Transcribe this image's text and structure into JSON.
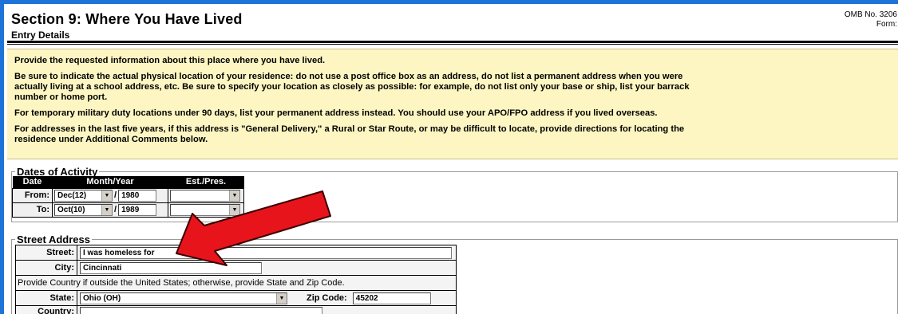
{
  "header": {
    "title": "Section 9: Where You Have Lived",
    "subtitle": "Entry Details",
    "omb_line1": "OMB No. 3206",
    "omb_line2": "Form:"
  },
  "instructions": {
    "p1": "Provide the requested information about this place where you have lived.",
    "p2a": "Be sure to indicate the actual physical location of your residence: do not use a post office box as an address, do not list a permanent address when you were",
    "p2b": "actually living at a school address, etc. Be sure to specify your location as closely as possible: for example, do not list only your base or ship, list your barrack",
    "p2c": "number or home port.",
    "p3": "For temporary military duty locations under 90 days, list your permanent address instead. You should use your APO/FPO address if you lived overseas.",
    "p4a": "For addresses in the last five years, if this address is \"General Delivery,\" a Rural or Star Route, or may be difficult to locate, provide directions for locating the",
    "p4b": "residence under Additional Comments below."
  },
  "dates": {
    "legend": "Dates of Activity",
    "col_date": "Date",
    "col_month_year": "Month/Year",
    "col_est": "Est./Pres.",
    "from_label": "From:",
    "from_month": "Dec(12)",
    "from_year": "1980",
    "from_est": "",
    "to_label": "To:",
    "to_month": "Oct(10)",
    "to_year": "1989",
    "to_est": "",
    "separator": "/"
  },
  "address": {
    "legend": "Street Address",
    "street_label": "Street:",
    "street_value": "I was homeless for",
    "city_label": "City:",
    "city_value": "Cincinnati",
    "note": "Provide Country if outside the United States; otherwise, provide State and Zip Code.",
    "state_label": "State:",
    "state_value": "Ohio (OH)",
    "zip_label": "Zip Code:",
    "zip_value": "45202",
    "country_label": "Country:",
    "country_value": ""
  },
  "annotation": {
    "arrow_color": "#e8141b"
  },
  "colors": {
    "frame_blue": "#1e73d8",
    "instruction_bg": "#fdf6c2"
  }
}
